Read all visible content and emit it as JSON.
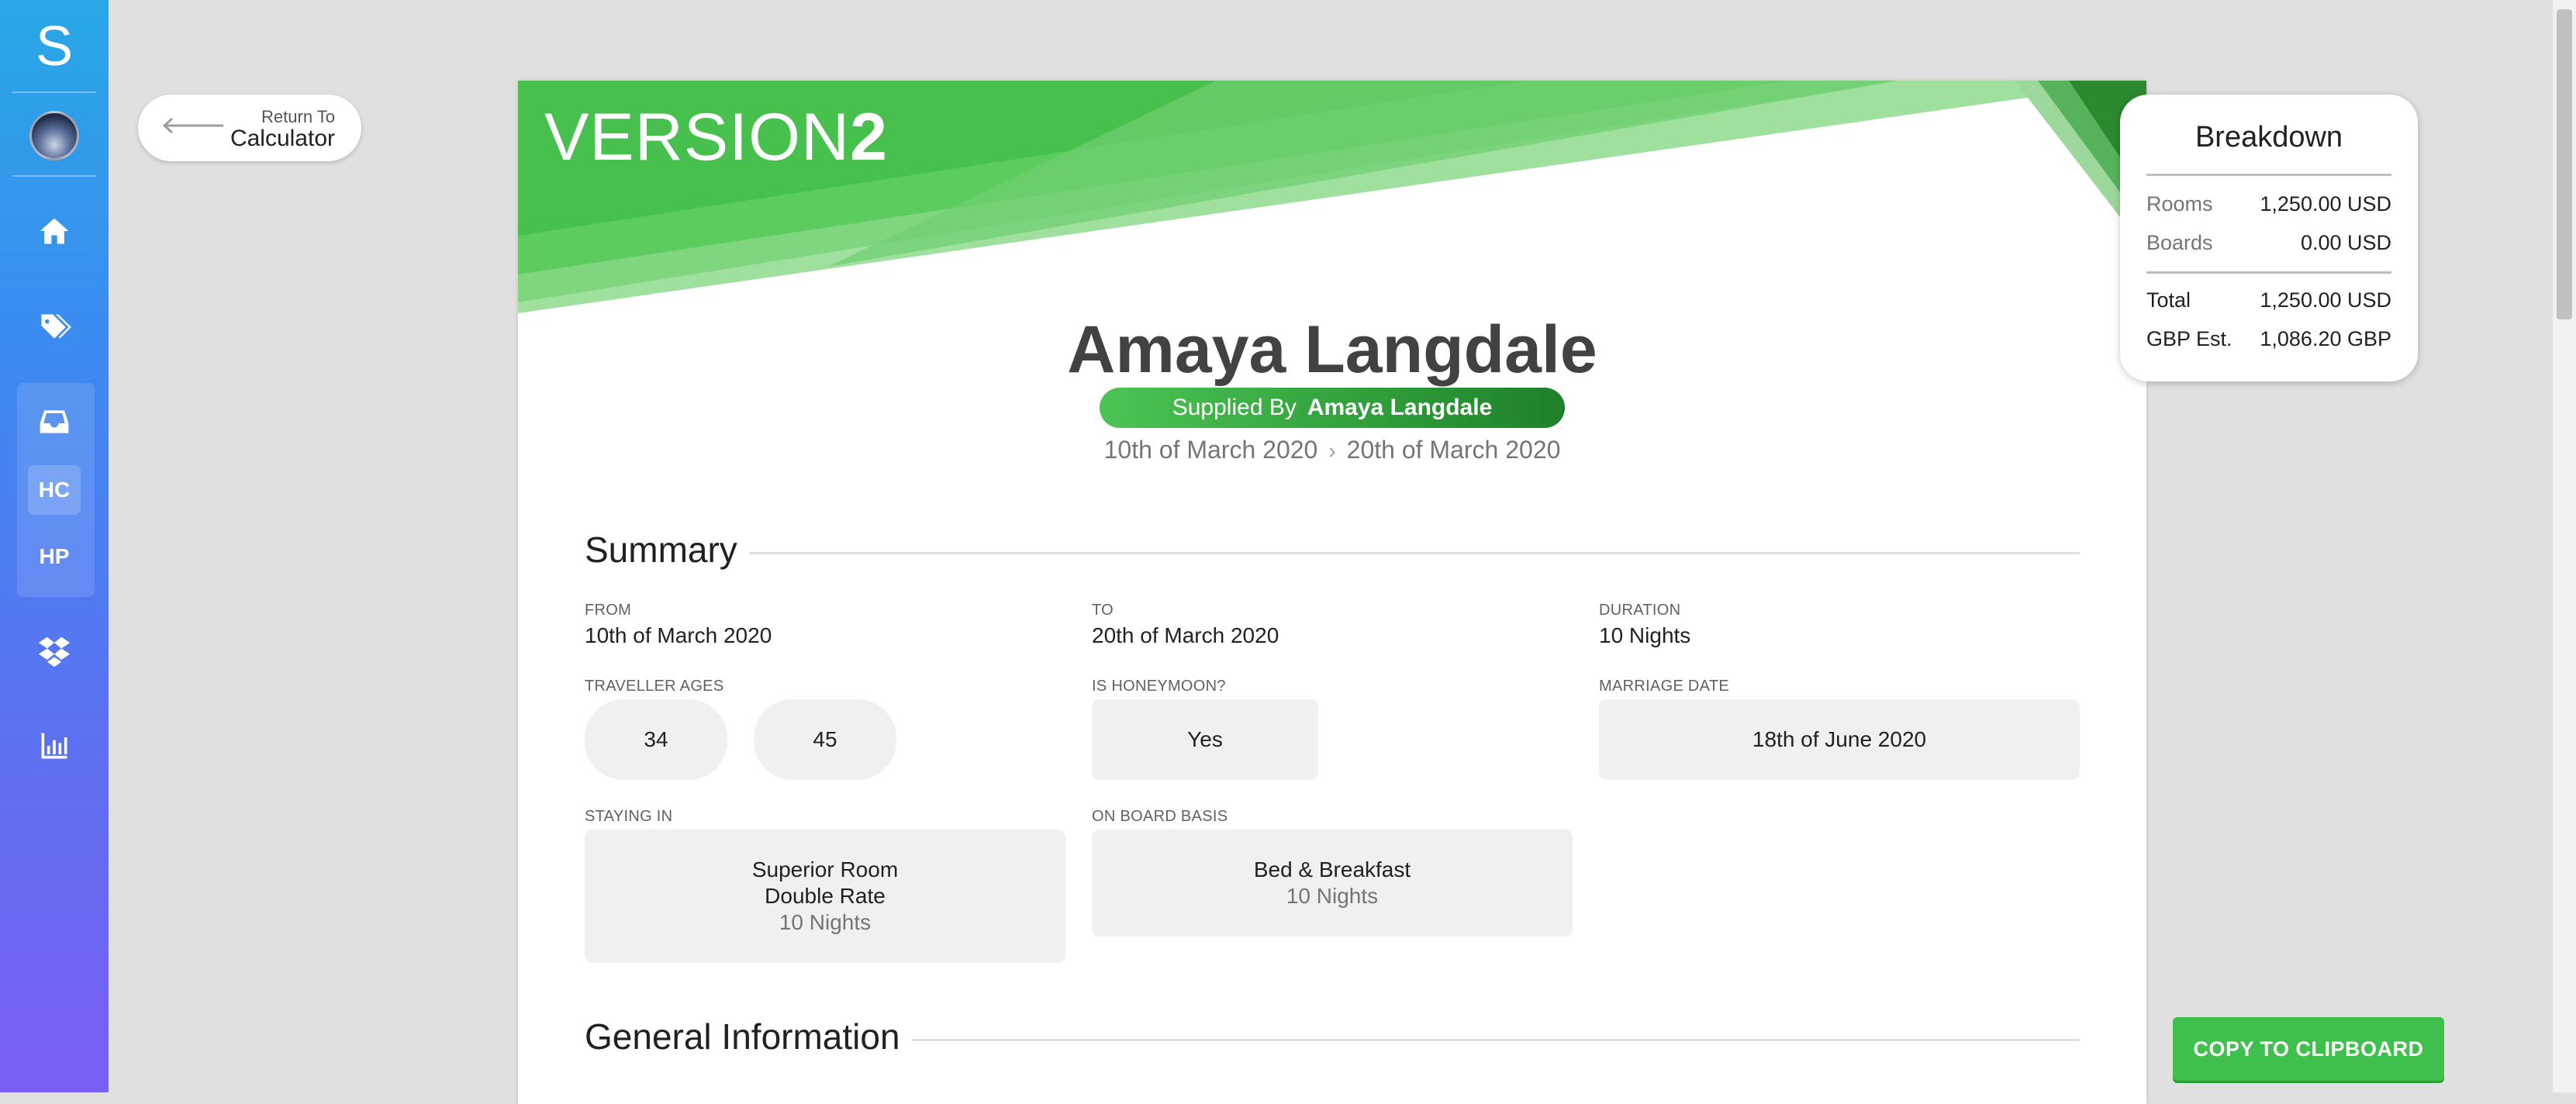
{
  "sidebar": {
    "logo": "S",
    "items": [
      {
        "icon": "home-icon"
      },
      {
        "icon": "tags-icon"
      },
      {
        "icon": "inbox-icon"
      },
      {
        "text": "HC"
      },
      {
        "text": "HP"
      },
      {
        "icon": "dropbox-icon"
      },
      {
        "icon": "bar-chart-icon"
      }
    ]
  },
  "return": {
    "small": "Return To",
    "big": "Calculator"
  },
  "banner": {
    "version_light": "VERSION",
    "version_bold": "2",
    "colors": [
      "#4cbf4f",
      "#7fd67f",
      "#2b8a2f"
    ]
  },
  "header": {
    "name": "Amaya Langdale",
    "supplied_label": "Supplied By",
    "supplied_name": "Amaya Langdale",
    "date_from": "10th of March 2020",
    "date_to": "20th of March 2020"
  },
  "summary": {
    "title": "Summary",
    "from_label": "From",
    "from_value": "10th of March 2020",
    "to_label": "To",
    "to_value": "20th of March 2020",
    "duration_label": "Duration",
    "duration_value": "10 Nights",
    "traveller_ages_label": "Traveller Ages",
    "traveller_ages": [
      "34",
      "45"
    ],
    "honeymoon_label": "Is Honeymoon?",
    "honeymoon_value": "Yes",
    "marriage_label": "Marriage Date",
    "marriage_value": "18th of June 2020",
    "staying_label": "Staying In",
    "room_line1": "Superior Room",
    "room_line2": "Double Rate",
    "room_nights": "10 Nights",
    "board_label": "On Board Basis",
    "board_line1": "Bed & Breakfast",
    "board_nights": "10 Nights"
  },
  "general": {
    "title": "General Information"
  },
  "breakdown": {
    "title": "Breakdown",
    "rooms_label": "Rooms",
    "rooms_value": "1,250.00 USD",
    "boards_label": "Boards",
    "boards_value": "0.00 USD",
    "total_label": "Total",
    "total_value": "1,250.00 USD",
    "gbp_label": "GBP Est.",
    "gbp_value": "1,086.20 GBP"
  },
  "copy_button": "COPY TO CLIPBOARD",
  "colors": {
    "accent_green": "#3fbf4b",
    "sidebar_top": "#28a8e6",
    "sidebar_bottom": "#7a5ef5"
  }
}
